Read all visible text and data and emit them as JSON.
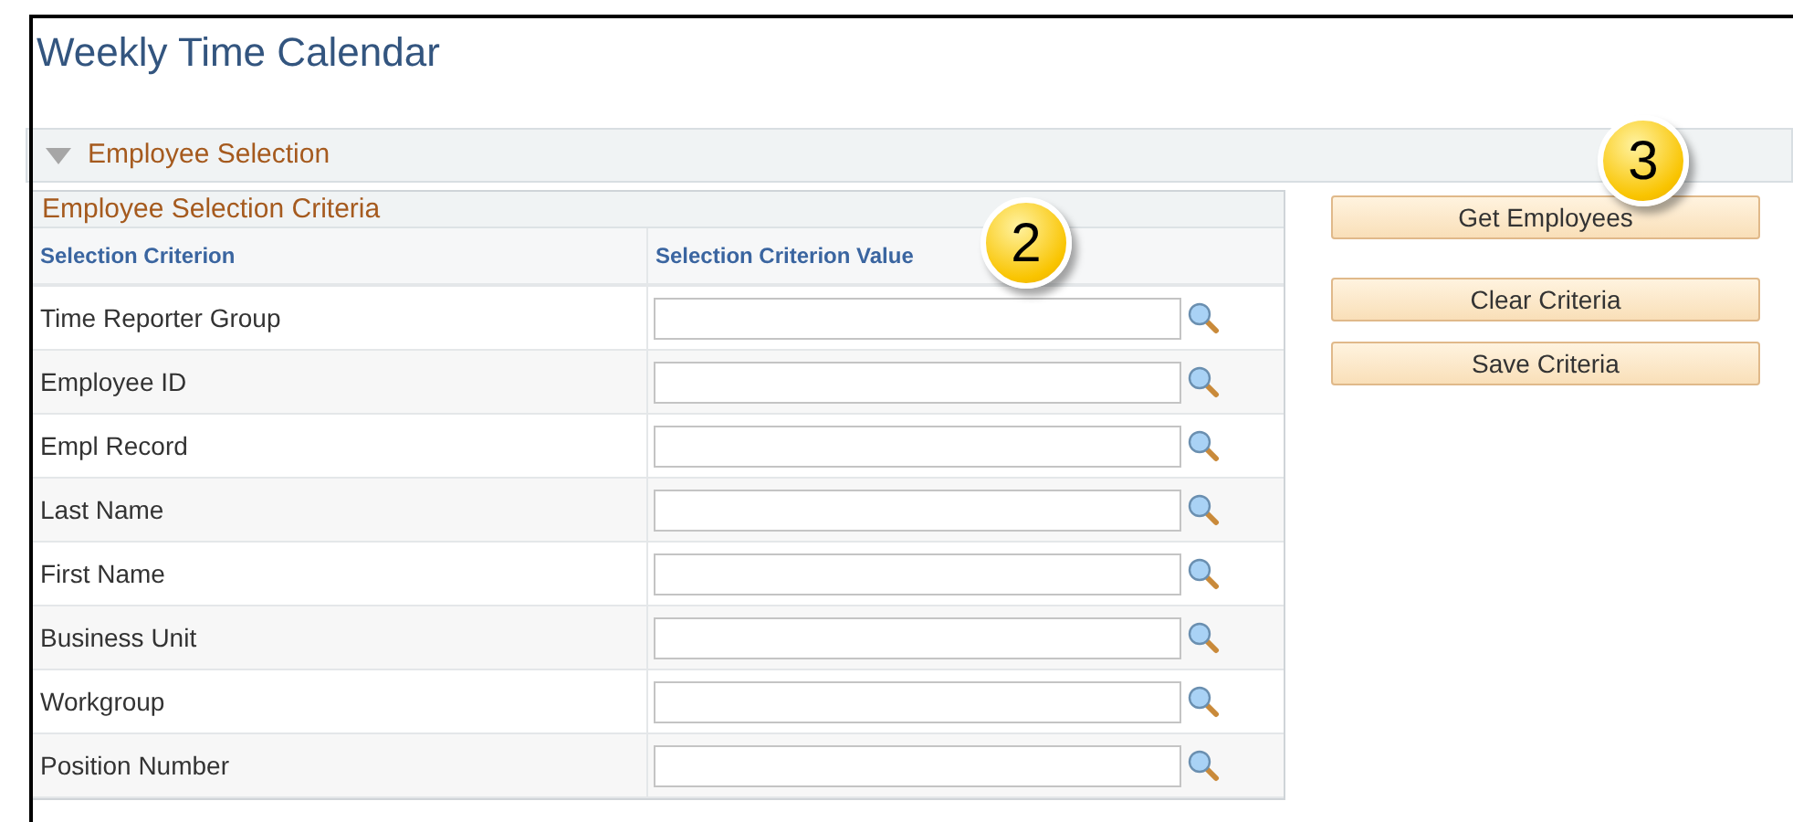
{
  "page_title": "Weekly Time Calendar",
  "section": {
    "title": "Employee Selection",
    "expanded": true
  },
  "criteria_table": {
    "title": "Employee Selection Criteria",
    "columns": [
      "Selection Criterion",
      "Selection Criterion Value"
    ],
    "rows": [
      {
        "label": "Time Reporter Group"
      },
      {
        "label": "Employee ID"
      },
      {
        "label": "Empl Record"
      },
      {
        "label": "Last Name"
      },
      {
        "label": "First Name"
      },
      {
        "label": "Business Unit"
      },
      {
        "label": "Workgroup"
      },
      {
        "label": "Position Number"
      }
    ]
  },
  "buttons": [
    {
      "label": "Get Employees"
    },
    {
      "label": "Clear Criteria"
    },
    {
      "label": "Save Criteria"
    }
  ],
  "callouts": [
    {
      "number": "2"
    },
    {
      "number": "3"
    }
  ]
}
